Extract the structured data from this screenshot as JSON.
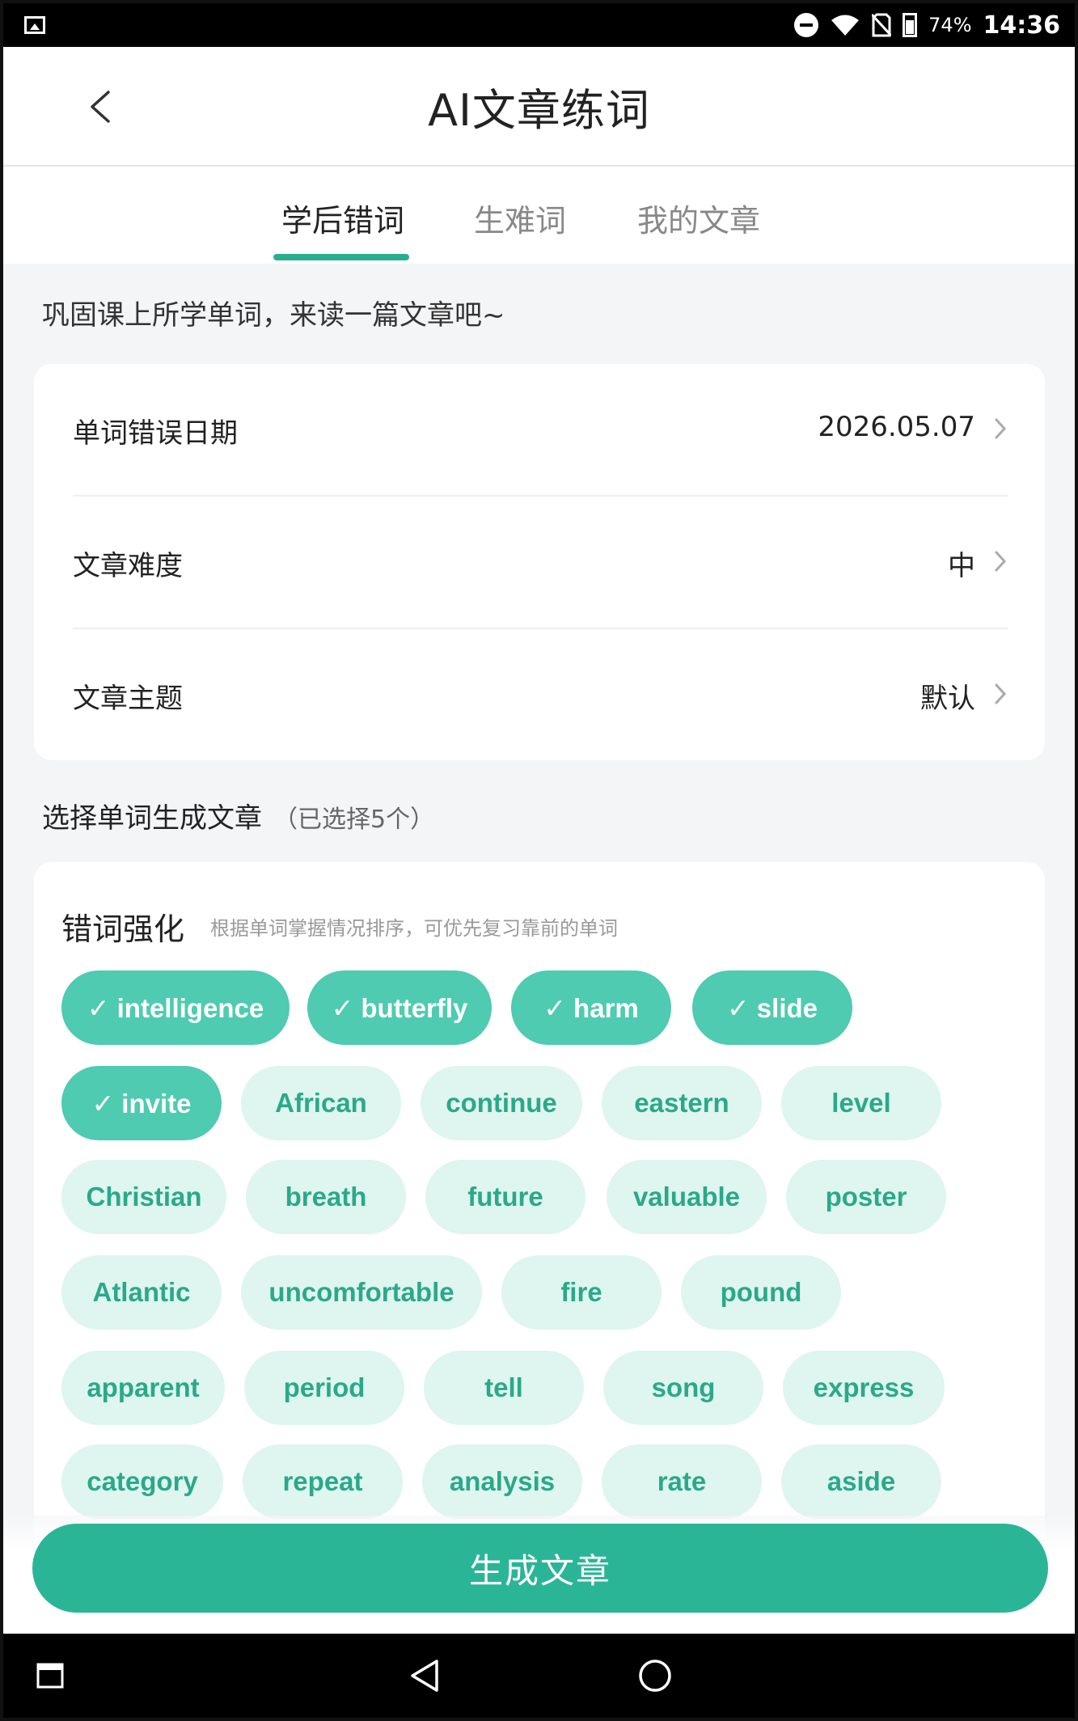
{
  "status_bar": {
    "battery_percent": "74%",
    "time": "14:36"
  },
  "header": {
    "title": "AI文章练词"
  },
  "tabs": [
    {
      "label": "学后错词",
      "active": true
    },
    {
      "label": "生难词",
      "active": false
    },
    {
      "label": "我的文章",
      "active": false
    }
  ],
  "tip": "巩固课上所学单词，来读一篇文章吧~",
  "settings": [
    {
      "label": "单词错误日期",
      "value": "2026.05.07"
    },
    {
      "label": "文章难度",
      "value": "中"
    },
    {
      "label": "文章主题",
      "value": "默认"
    }
  ],
  "section": {
    "title": "选择单词生成文章",
    "count": "（已选择5个）"
  },
  "words_panel": {
    "heading": "错词强化",
    "hint": "根据单词掌握情况排序，可优先复习靠前的单词",
    "words": [
      {
        "text": "✓ intelligence",
        "selected": true
      },
      {
        "text": "✓ butterfly",
        "selected": true
      },
      {
        "text": "✓ harm",
        "selected": true
      },
      {
        "text": "✓ slide",
        "selected": true
      },
      {
        "text": "✓ invite",
        "selected": true
      },
      {
        "text": "African",
        "selected": false
      },
      {
        "text": "continue",
        "selected": false
      },
      {
        "text": "eastern",
        "selected": false
      },
      {
        "text": "level",
        "selected": false
      },
      {
        "text": "Christian",
        "selected": false
      },
      {
        "text": "breath",
        "selected": false
      },
      {
        "text": "future",
        "selected": false
      },
      {
        "text": "valuable",
        "selected": false
      },
      {
        "text": "poster",
        "selected": false
      },
      {
        "text": "Atlantic",
        "selected": false
      },
      {
        "text": "uncomfortable",
        "selected": false
      },
      {
        "text": "fire",
        "selected": false
      },
      {
        "text": "pound",
        "selected": false
      },
      {
        "text": "apparent",
        "selected": false
      },
      {
        "text": "period",
        "selected": false
      },
      {
        "text": "tell",
        "selected": false
      },
      {
        "text": "song",
        "selected": false
      },
      {
        "text": "express",
        "selected": false
      },
      {
        "text": "category",
        "selected": false
      },
      {
        "text": "repeat",
        "selected": false
      },
      {
        "text": "analysis",
        "selected": false
      },
      {
        "text": "rate",
        "selected": false
      },
      {
        "text": "aside",
        "selected": false
      }
    ]
  },
  "generate_button": "生成文章",
  "colors": {
    "accent": "#2bb597",
    "chip_selected": "#4ecbb0",
    "chip_unselected_bg": "#dff5ef",
    "chip_unselected_text": "#2aa98a"
  }
}
